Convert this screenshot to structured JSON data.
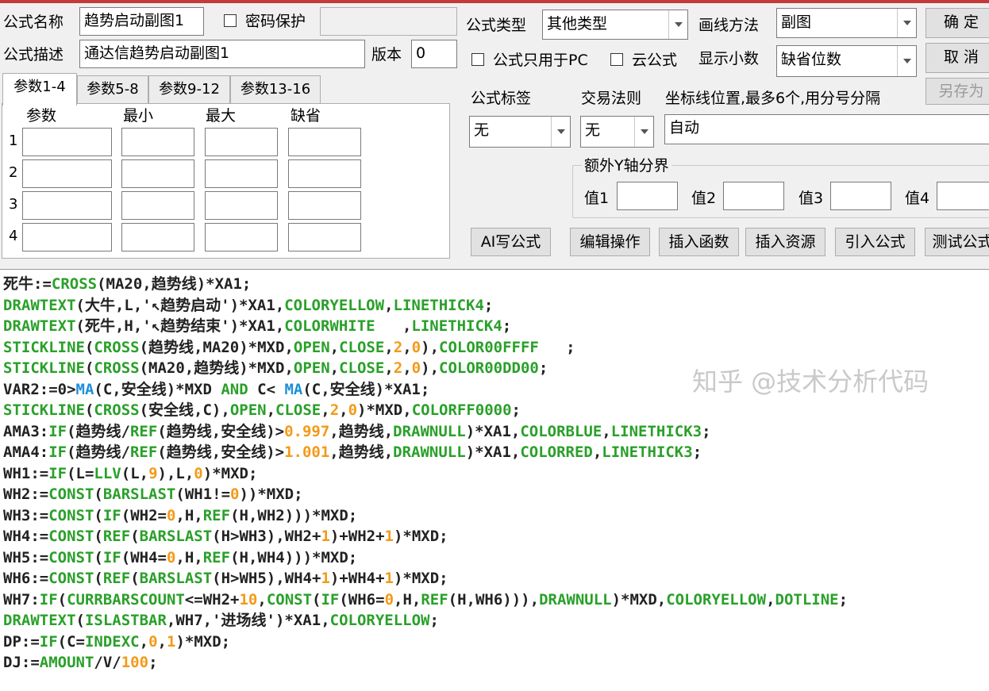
{
  "form": {
    "name_label": "公式名称",
    "name_value": "趋势启动副图1",
    "password_label": "密码保护",
    "desc_label": "公式描述",
    "desc_value": "通达信趋势启动副图1",
    "version_label": "版本",
    "version_value": "0",
    "type_label": "公式类型",
    "type_value": "其他类型",
    "draw_label": "画线方法",
    "draw_value": "副图",
    "pc_only_label": "公式只用于PC",
    "cloud_label": "云公式",
    "decimals_label": "显示小数",
    "decimals_value": "缺省位数",
    "tag_label": "公式标签",
    "tag_value": "无",
    "trade_label": "交易法则",
    "trade_value": "无",
    "axis_label": "坐标线位置,最多6个,用分号分隔",
    "axis_value": "自动",
    "extra_y_label": "额外Y轴分界",
    "val1_label": "值1",
    "val2_label": "值2",
    "val3_label": "值3",
    "val4_label": "值4"
  },
  "buttons": {
    "ok": "确 定",
    "cancel": "取 消",
    "save_as": "另存为",
    "ai": "AI写公式",
    "edit": "编辑操作",
    "insert_func": "插入函数",
    "insert_res": "插入资源",
    "import": "引入公式",
    "test": "测试公式"
  },
  "params": {
    "tabs": [
      "参数1-4",
      "参数5-8",
      "参数9-12",
      "参数13-16"
    ],
    "columns": [
      "参数",
      "最小",
      "最大",
      "缺省"
    ],
    "rows": [
      "1",
      "2",
      "3",
      "4"
    ]
  },
  "code": [
    [
      [
        "死牛:=",
        ""
      ],
      [
        "CROSS",
        "g"
      ],
      [
        "(MA20,趋势线)*XA1;",
        ""
      ]
    ],
    [
      [
        "DRAWTEXT",
        "g"
      ],
      [
        "(大牛,L,'↖趋势启动')*XA1,",
        ""
      ],
      [
        "COLORYELLOW",
        "g"
      ],
      [
        ",",
        ""
      ],
      [
        "LINETHICK4",
        "g"
      ],
      [
        ";",
        ""
      ]
    ],
    [
      [
        "DRAWTEXT",
        "g"
      ],
      [
        "(死牛,H,'↖趋势结束')*XA1,",
        ""
      ],
      [
        "COLORWHITE",
        "g"
      ],
      [
        "   ,",
        ""
      ],
      [
        "LINETHICK4",
        "g"
      ],
      [
        ";",
        ""
      ]
    ],
    [
      [
        "STICKLINE",
        "g"
      ],
      [
        "(",
        ""
      ],
      [
        "CROSS",
        "g"
      ],
      [
        "(趋势线,MA20)*MXD,",
        ""
      ],
      [
        "OPEN",
        "g"
      ],
      [
        ",",
        ""
      ],
      [
        "CLOSE",
        "g"
      ],
      [
        ",",
        ""
      ],
      [
        "2",
        "o"
      ],
      [
        ",",
        ""
      ],
      [
        "0",
        "o"
      ],
      [
        "),",
        ""
      ],
      [
        "COLOR00FFFF",
        "g"
      ],
      [
        "   ;",
        ""
      ]
    ],
    [
      [
        "STICKLINE",
        "g"
      ],
      [
        "(",
        ""
      ],
      [
        "CROSS",
        "g"
      ],
      [
        "(MA20,趋势线)*MXD,",
        ""
      ],
      [
        "OPEN",
        "g"
      ],
      [
        ",",
        ""
      ],
      [
        "CLOSE",
        "g"
      ],
      [
        ",",
        ""
      ],
      [
        "2",
        "o"
      ],
      [
        ",",
        ""
      ],
      [
        "0",
        "o"
      ],
      [
        "),",
        ""
      ],
      [
        "COLOR00DD00",
        "g"
      ],
      [
        ";",
        ""
      ]
    ],
    [
      [
        "VAR2:=0>",
        ""
      ],
      [
        "MA",
        "b"
      ],
      [
        "(C,安全线)*MXD ",
        ""
      ],
      [
        "AND",
        "g"
      ],
      [
        " C< ",
        ""
      ],
      [
        "MA",
        "b"
      ],
      [
        "(C,安全线)*XA1;",
        ""
      ]
    ],
    [
      [
        "STICKLINE",
        "g"
      ],
      [
        "(",
        ""
      ],
      [
        "CROSS",
        "g"
      ],
      [
        "(安全线,C),",
        ""
      ],
      [
        "OPEN",
        "g"
      ],
      [
        ",",
        ""
      ],
      [
        "CLOSE",
        "g"
      ],
      [
        ",",
        ""
      ],
      [
        "2",
        "o"
      ],
      [
        ",",
        ""
      ],
      [
        "0",
        "o"
      ],
      [
        ")*MXD,",
        ""
      ],
      [
        "COLORFF0000",
        "g"
      ],
      [
        ";",
        ""
      ]
    ],
    [
      [
        "AMA3:",
        ""
      ],
      [
        "IF",
        "g"
      ],
      [
        "(趋势线/",
        ""
      ],
      [
        "REF",
        "g"
      ],
      [
        "(趋势线,安全线)>",
        ""
      ],
      [
        "0.997",
        "o"
      ],
      [
        ",趋势线,",
        ""
      ],
      [
        "DRAWNULL",
        "g"
      ],
      [
        ")*XA1,",
        ""
      ],
      [
        "COLORBLUE",
        "g"
      ],
      [
        ",",
        ""
      ],
      [
        "LINETHICK3",
        "g"
      ],
      [
        ";",
        ""
      ]
    ],
    [
      [
        "AMA4:",
        ""
      ],
      [
        "IF",
        "g"
      ],
      [
        "(趋势线/",
        ""
      ],
      [
        "REF",
        "g"
      ],
      [
        "(趋势线,安全线)>",
        ""
      ],
      [
        "1.001",
        "o"
      ],
      [
        ",趋势线,",
        ""
      ],
      [
        "DRAWNULL",
        "g"
      ],
      [
        ")*XA1,",
        ""
      ],
      [
        "COLORRED",
        "g"
      ],
      [
        ",",
        ""
      ],
      [
        "LINETHICK3",
        "g"
      ],
      [
        ";",
        ""
      ]
    ],
    [
      [
        "WH1:=",
        ""
      ],
      [
        "IF",
        "g"
      ],
      [
        "(L=",
        ""
      ],
      [
        "LLV",
        "g"
      ],
      [
        "(L,",
        ""
      ],
      [
        "9",
        "o"
      ],
      [
        "),L,",
        ""
      ],
      [
        "0",
        "o"
      ],
      [
        ")*MXD;",
        ""
      ]
    ],
    [
      [
        "WH2:=",
        ""
      ],
      [
        "CONST",
        "g"
      ],
      [
        "(",
        ""
      ],
      [
        "BARSLAST",
        "g"
      ],
      [
        "(WH1!=",
        ""
      ],
      [
        "0",
        "o"
      ],
      [
        "))*MXD;",
        ""
      ]
    ],
    [
      [
        "WH3:=",
        ""
      ],
      [
        "CONST",
        "g"
      ],
      [
        "(",
        ""
      ],
      [
        "IF",
        "g"
      ],
      [
        "(WH2=",
        ""
      ],
      [
        "0",
        "o"
      ],
      [
        ",H,",
        ""
      ],
      [
        "REF",
        "g"
      ],
      [
        "(H,WH2)))*MXD;",
        ""
      ]
    ],
    [
      [
        "WH4:=",
        ""
      ],
      [
        "CONST",
        "g"
      ],
      [
        "(",
        ""
      ],
      [
        "REF",
        "g"
      ],
      [
        "(",
        ""
      ],
      [
        "BARSLAST",
        "g"
      ],
      [
        "(H>WH3),WH2+",
        ""
      ],
      [
        "1",
        "o"
      ],
      [
        ")+WH2+",
        ""
      ],
      [
        "1",
        "o"
      ],
      [
        ")*MXD;",
        ""
      ]
    ],
    [
      [
        "WH5:=",
        ""
      ],
      [
        "CONST",
        "g"
      ],
      [
        "(",
        ""
      ],
      [
        "IF",
        "g"
      ],
      [
        "(WH4=",
        ""
      ],
      [
        "0",
        "o"
      ],
      [
        ",H,",
        ""
      ],
      [
        "REF",
        "g"
      ],
      [
        "(H,WH4)))*MXD;",
        ""
      ]
    ],
    [
      [
        "WH6:=",
        ""
      ],
      [
        "CONST",
        "g"
      ],
      [
        "(",
        ""
      ],
      [
        "REF",
        "g"
      ],
      [
        "(",
        ""
      ],
      [
        "BARSLAST",
        "g"
      ],
      [
        "(H>WH5),WH4+",
        ""
      ],
      [
        "1",
        "o"
      ],
      [
        ")+WH4+",
        ""
      ],
      [
        "1",
        "o"
      ],
      [
        ")*MXD;",
        ""
      ]
    ],
    [
      [
        "WH7:",
        ""
      ],
      [
        "IF",
        "g"
      ],
      [
        "(",
        ""
      ],
      [
        "CURRBARSCOUNT",
        "g"
      ],
      [
        "<=WH2+",
        ""
      ],
      [
        "10",
        "o"
      ],
      [
        ",",
        ""
      ],
      [
        "CONST",
        "g"
      ],
      [
        "(",
        ""
      ],
      [
        "IF",
        "g"
      ],
      [
        "(WH6=",
        ""
      ],
      [
        "0",
        "o"
      ],
      [
        ",H,",
        ""
      ],
      [
        "REF",
        "g"
      ],
      [
        "(H,WH6))),",
        ""
      ],
      [
        "DRAWNULL",
        "g"
      ],
      [
        ")*MXD,",
        ""
      ],
      [
        "COLORYELLOW",
        "g"
      ],
      [
        ",",
        ""
      ],
      [
        "DOTLINE",
        "g"
      ],
      [
        ";",
        ""
      ]
    ],
    [
      [
        "DRAWTEXT",
        "g"
      ],
      [
        "(",
        ""
      ],
      [
        "ISLASTBAR",
        "g"
      ],
      [
        ",WH7,'进场线')*XA1,",
        ""
      ],
      [
        "COLORYELLOW",
        "g"
      ],
      [
        ";",
        ""
      ]
    ],
    [
      [
        "DP:=",
        ""
      ],
      [
        "IF",
        "g"
      ],
      [
        "(C=",
        ""
      ],
      [
        "INDEXC",
        "g"
      ],
      [
        ",",
        ""
      ],
      [
        "0",
        "o"
      ],
      [
        ",",
        ""
      ],
      [
        "1",
        "o"
      ],
      [
        ")*MXD;",
        ""
      ]
    ],
    [
      [
        "DJ:=",
        ""
      ],
      [
        "AMOUNT",
        "g"
      ],
      [
        "/V/",
        ""
      ],
      [
        "100",
        "o"
      ],
      [
        ";",
        ""
      ]
    ]
  ],
  "watermark": "知乎 @技术分析代码"
}
